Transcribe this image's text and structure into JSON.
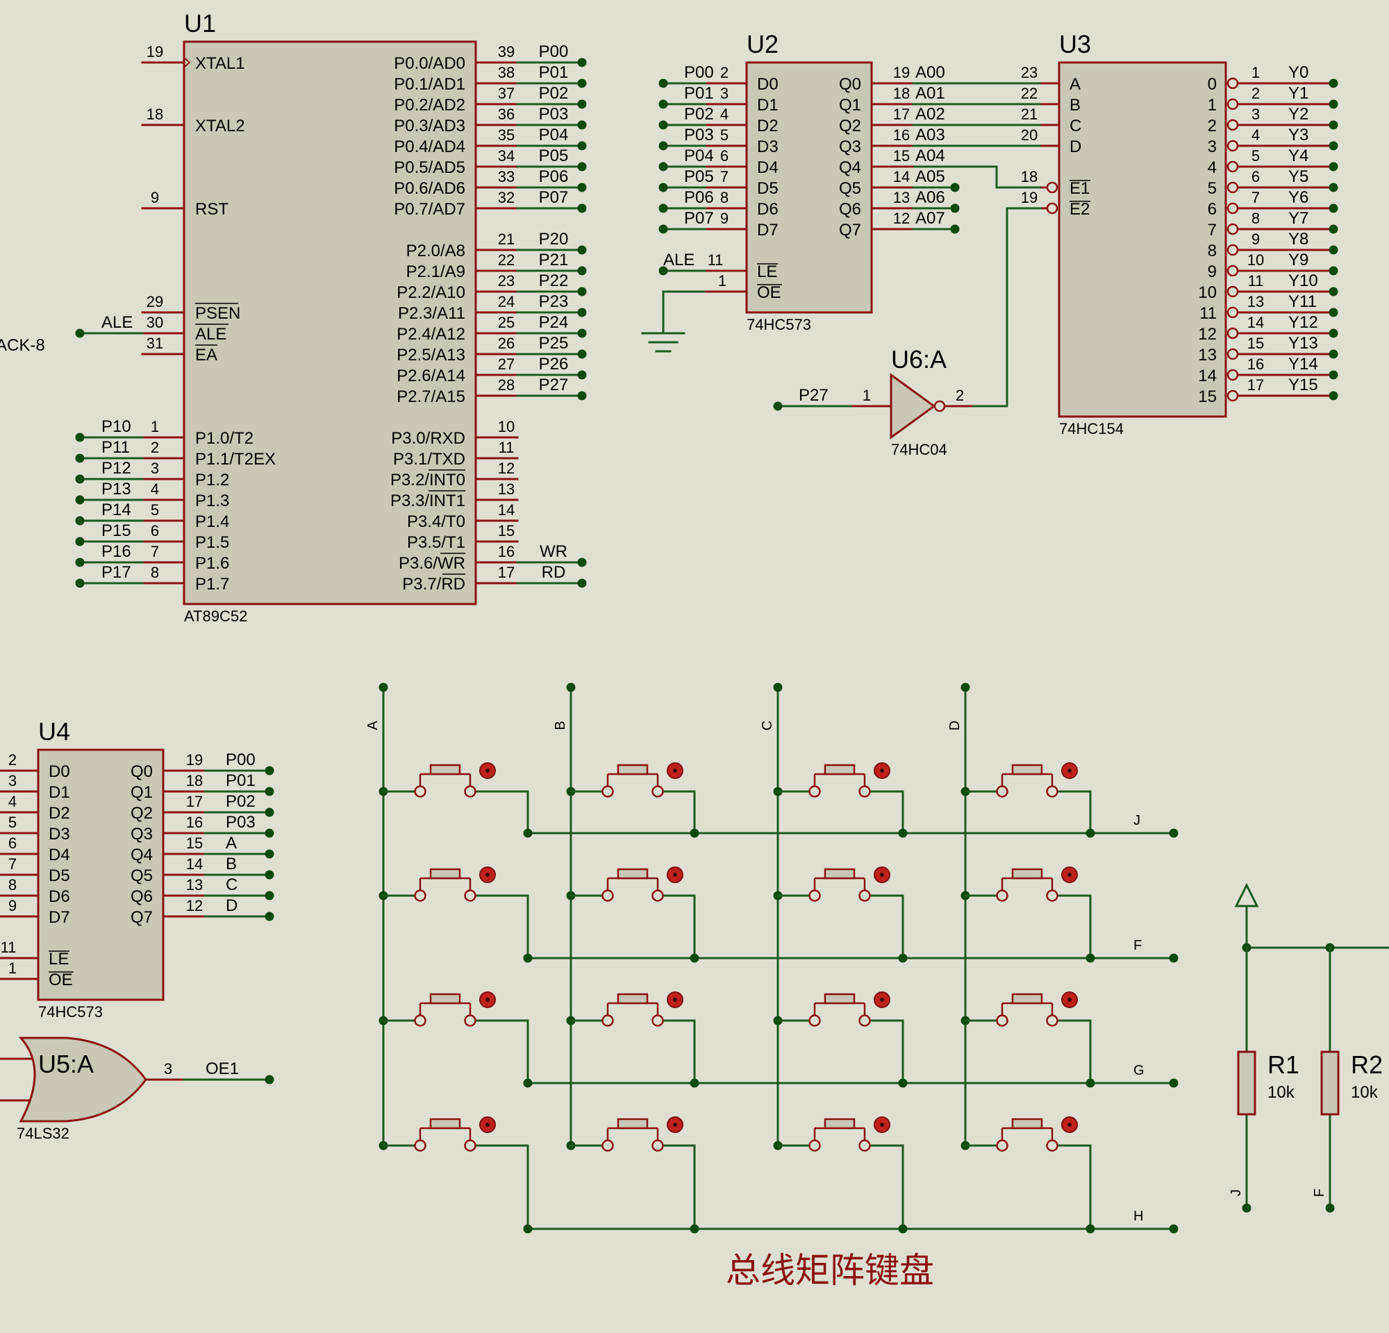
{
  "colors": {
    "background": "#e0e0d2",
    "component_fill": "#c8c8b4",
    "component_border": "#8b1010",
    "wire": "#1e5a1e",
    "junction": "#0b4a0b",
    "title": "#8b1010"
  },
  "title": "总线矩阵键盘",
  "u1": {
    "ref": "U1",
    "part": "AT89C52",
    "left_pins": [
      {
        "num": "19",
        "name": "XTAL1"
      },
      {
        "num": "18",
        "name": "XTAL2"
      },
      {
        "num": "9",
        "name": "RST"
      },
      {
        "num": "29",
        "name": "PSEN"
      },
      {
        "num": "30",
        "name": "ALE"
      },
      {
        "num": "31",
        "name": "EA"
      },
      {
        "num": "1",
        "name": "P1.0/T2",
        "net": "P10"
      },
      {
        "num": "2",
        "name": "P1.1/T2EX",
        "net": "P11"
      },
      {
        "num": "3",
        "name": "P1.2",
        "net": "P12"
      },
      {
        "num": "4",
        "name": "P1.3",
        "net": "P13"
      },
      {
        "num": "5",
        "name": "P1.4",
        "net": "P14"
      },
      {
        "num": "6",
        "name": "P1.5",
        "net": "P15"
      },
      {
        "num": "7",
        "name": "P1.6",
        "net": "P16"
      },
      {
        "num": "8",
        "name": "P1.7",
        "net": "P17"
      }
    ],
    "ale_net": "ALE",
    "right_pins": [
      {
        "num": "39",
        "name": "P0.0/AD0",
        "net": "P00"
      },
      {
        "num": "38",
        "name": "P0.1/AD1",
        "net": "P01"
      },
      {
        "num": "37",
        "name": "P0.2/AD2",
        "net": "P02"
      },
      {
        "num": "36",
        "name": "P0.3/AD3",
        "net": "P03"
      },
      {
        "num": "35",
        "name": "P0.4/AD4",
        "net": "P04"
      },
      {
        "num": "34",
        "name": "P0.5/AD5",
        "net": "P05"
      },
      {
        "num": "33",
        "name": "P0.6/AD6",
        "net": "P06"
      },
      {
        "num": "32",
        "name": "P0.7/AD7",
        "net": "P07"
      },
      {
        "num": "21",
        "name": "P2.0/A8",
        "net": "P20"
      },
      {
        "num": "22",
        "name": "P2.1/A9",
        "net": "P21"
      },
      {
        "num": "23",
        "name": "P2.2/A10",
        "net": "P22"
      },
      {
        "num": "24",
        "name": "P2.3/A11",
        "net": "P23"
      },
      {
        "num": "25",
        "name": "P2.4/A12",
        "net": "P24"
      },
      {
        "num": "26",
        "name": "P2.5/A13",
        "net": "P25"
      },
      {
        "num": "27",
        "name": "P2.6/A14",
        "net": "P26"
      },
      {
        "num": "28",
        "name": "P2.7/A15",
        "net": "P27"
      },
      {
        "num": "10",
        "name": "P3.0/RXD",
        "net": ""
      },
      {
        "num": "11",
        "name": "P3.1/TXD",
        "net": ""
      },
      {
        "num": "12",
        "name": "P3.2/INT0",
        "net": ""
      },
      {
        "num": "13",
        "name": "P3.3/INT1",
        "net": ""
      },
      {
        "num": "14",
        "name": "P3.4/T0",
        "net": ""
      },
      {
        "num": "15",
        "name": "P3.5/T1",
        "net": ""
      },
      {
        "num": "16",
        "name": "P3.6/WR",
        "net": "WR"
      },
      {
        "num": "17",
        "name": "P3.7/RD",
        "net": "RD"
      }
    ]
  },
  "cut_label": "ACK-8",
  "u2": {
    "ref": "U2",
    "part": "74HC573",
    "inputs": [
      {
        "num": "2",
        "name": "D0",
        "net": "P00"
      },
      {
        "num": "3",
        "name": "D1",
        "net": "P01"
      },
      {
        "num": "4",
        "name": "D2",
        "net": "P02"
      },
      {
        "num": "5",
        "name": "D3",
        "net": "P03"
      },
      {
        "num": "6",
        "name": "D4",
        "net": "P04"
      },
      {
        "num": "7",
        "name": "D5",
        "net": "P05"
      },
      {
        "num": "8",
        "name": "D6",
        "net": "P06"
      },
      {
        "num": "9",
        "name": "D7",
        "net": "P07"
      }
    ],
    "outputs": [
      {
        "num": "19",
        "name": "Q0",
        "net": "A00"
      },
      {
        "num": "18",
        "name": "Q1",
        "net": "A01"
      },
      {
        "num": "17",
        "name": "Q2",
        "net": "A02"
      },
      {
        "num": "16",
        "name": "Q3",
        "net": "A03"
      },
      {
        "num": "15",
        "name": "Q4",
        "net": "A04"
      },
      {
        "num": "14",
        "name": "Q5",
        "net": "A05"
      },
      {
        "num": "13",
        "name": "Q6",
        "net": "A06"
      },
      {
        "num": "12",
        "name": "Q7",
        "net": "A07"
      }
    ],
    "le": {
      "num": "11",
      "name": "LE",
      "net": "ALE"
    },
    "oe": {
      "num": "1",
      "name": "OE"
    }
  },
  "u3": {
    "ref": "U3",
    "part": "74HC154",
    "inputs": [
      {
        "num": "23",
        "name": "A"
      },
      {
        "num": "22",
        "name": "B"
      },
      {
        "num": "21",
        "name": "C"
      },
      {
        "num": "20",
        "name": "D"
      },
      {
        "num": "18",
        "name": "E1"
      },
      {
        "num": "19",
        "name": "E2"
      }
    ],
    "outputs": [
      {
        "idx": "0",
        "num": "1",
        "net": "Y0"
      },
      {
        "idx": "1",
        "num": "2",
        "net": "Y1"
      },
      {
        "idx": "2",
        "num": "3",
        "net": "Y2"
      },
      {
        "idx": "3",
        "num": "4",
        "net": "Y3"
      },
      {
        "idx": "4",
        "num": "5",
        "net": "Y4"
      },
      {
        "idx": "5",
        "num": "6",
        "net": "Y5"
      },
      {
        "idx": "6",
        "num": "7",
        "net": "Y6"
      },
      {
        "idx": "7",
        "num": "8",
        "net": "Y7"
      },
      {
        "idx": "8",
        "num": "9",
        "net": "Y8"
      },
      {
        "idx": "9",
        "num": "10",
        "net": "Y9"
      },
      {
        "idx": "10",
        "num": "11",
        "net": "Y10"
      },
      {
        "idx": "11",
        "num": "13",
        "net": "Y11"
      },
      {
        "idx": "12",
        "num": "14",
        "net": "Y12"
      },
      {
        "idx": "13",
        "num": "15",
        "net": "Y13"
      },
      {
        "idx": "14",
        "num": "16",
        "net": "Y14"
      },
      {
        "idx": "15",
        "num": "17",
        "net": "Y15"
      }
    ]
  },
  "u6": {
    "ref": "U6:A",
    "part": "74HC04",
    "in_num": "1",
    "out_num": "2",
    "in_net": "P27"
  },
  "u4": {
    "ref": "U4",
    "part": "74HC573",
    "inputs": [
      {
        "num": "2",
        "name": "D0"
      },
      {
        "num": "3",
        "name": "D1"
      },
      {
        "num": "4",
        "name": "D2"
      },
      {
        "num": "5",
        "name": "D3"
      },
      {
        "num": "6",
        "name": "D4"
      },
      {
        "num": "7",
        "name": "D5"
      },
      {
        "num": "8",
        "name": "D6"
      },
      {
        "num": "9",
        "name": "D7"
      }
    ],
    "outputs": [
      {
        "num": "19",
        "name": "Q0",
        "net": "P00"
      },
      {
        "num": "18",
        "name": "Q1",
        "net": "P01"
      },
      {
        "num": "17",
        "name": "Q2",
        "net": "P02"
      },
      {
        "num": "16",
        "name": "Q3",
        "net": "P03"
      },
      {
        "num": "15",
        "name": "Q4",
        "net": "A"
      },
      {
        "num": "14",
        "name": "Q5",
        "net": "B"
      },
      {
        "num": "13",
        "name": "Q6",
        "net": "C"
      },
      {
        "num": "12",
        "name": "Q7",
        "net": "D"
      }
    ],
    "le": {
      "num": "11",
      "name": "LE"
    },
    "oe": {
      "num": "1",
      "name": "OE"
    }
  },
  "u5": {
    "ref": "U5:A",
    "part": "74LS32",
    "out_num": "3",
    "out_net": "OE1"
  },
  "keyboard": {
    "columns": [
      "A",
      "B",
      "C",
      "D"
    ],
    "rows": [
      "J",
      "F",
      "G",
      "H"
    ]
  },
  "resistors": [
    {
      "ref": "R1",
      "value": "10k",
      "net": "J"
    },
    {
      "ref": "R2",
      "value": "10k",
      "net": "F"
    }
  ]
}
